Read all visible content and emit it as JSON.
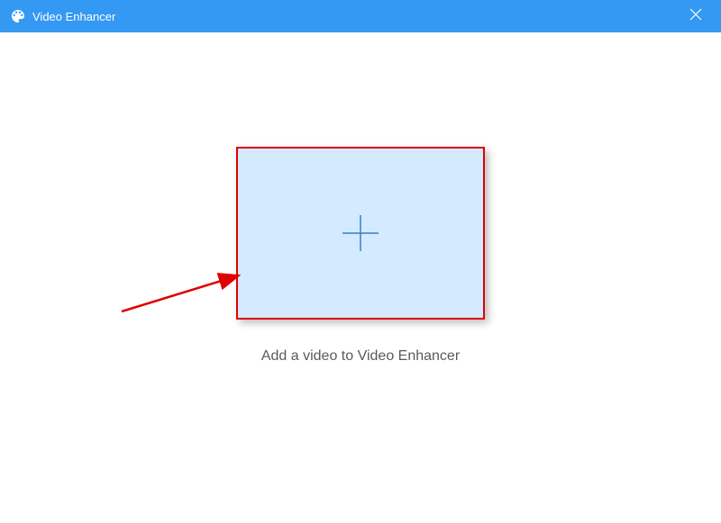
{
  "titlebar": {
    "app_title": "Video Enhancer"
  },
  "main": {
    "caption": "Add a video to Video Enhancer"
  },
  "colors": {
    "accent": "#3399f3",
    "annotation": "#e10000",
    "dropzone_bg": "#d3eaff",
    "plus_stroke": "#3b7fc4"
  }
}
